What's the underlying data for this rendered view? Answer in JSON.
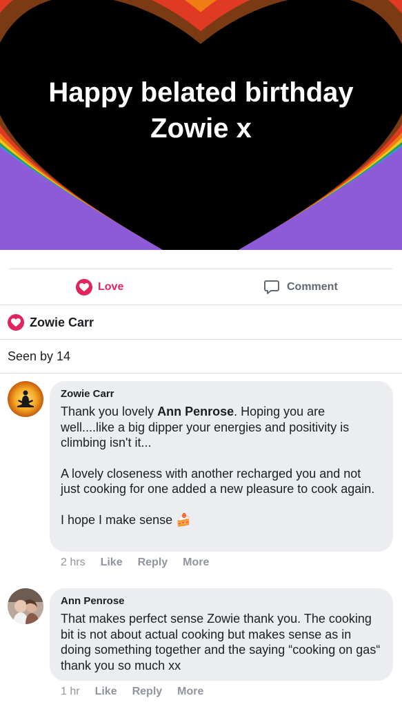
{
  "banner": {
    "line1": "Happy belated birthday",
    "line2": "Zowie x"
  },
  "actions": {
    "love_label": "Love",
    "comment_label": "Comment"
  },
  "reactions": {
    "name": "Zowie Carr"
  },
  "seen": "Seen by 14",
  "comments": [
    {
      "author": "Zowie Carr",
      "p1_pre": "Thank you lovely ",
      "p1_mention": "Ann Penrose",
      "p1_post": ". Hoping you are well....like a big dipper your energies and positivity is climbing isn't it...",
      "p2": "A lovely closeness with another recharged you and not just cooking for one added a new pleasure to cook again.",
      "p3": "I hope I make sense ",
      "p3_emoji": "🍰",
      "time": "2 hrs",
      "like": "Like",
      "reply": "Reply",
      "more": "More"
    },
    {
      "author": "Ann Penrose",
      "text": "That makes perfect sense Zowie thank you. The cooking bit is not about actual cooking but makes sense as in doing something together and the saying “cooking on gas“ thank you so much xx",
      "time": "1 hr",
      "like": "Like",
      "reply": "Reply",
      "more": "More"
    }
  ],
  "colors": {
    "love": "#e0245e",
    "muted": "#606770",
    "bubble": "#ebedf0"
  }
}
